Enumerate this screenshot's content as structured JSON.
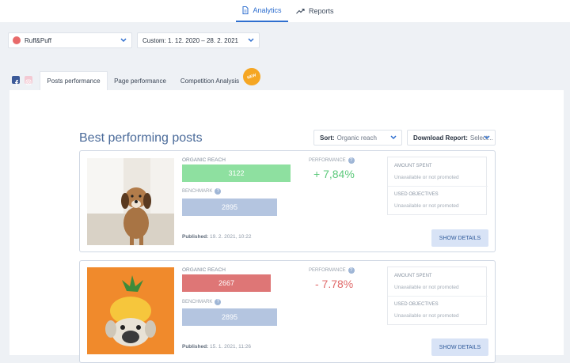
{
  "nav": {
    "analytics": "Analytics",
    "reports": "Reports"
  },
  "filters": {
    "page": "Ruff&Puff",
    "date_range": "Custom: 1. 12. 2020 – 28. 2. 2021"
  },
  "tabs": [
    "Posts performance",
    "Page performance",
    "Competition Analysis"
  ],
  "new_badge": "NEW",
  "section_title": "Best performing posts",
  "sort": {
    "label": "Sort:",
    "value": "Organic reach"
  },
  "download": {
    "label": "Download Report:",
    "value": "Select..."
  },
  "labels": {
    "organic_reach": "ORGANIC REACH",
    "benchmark": "BENCHMARK",
    "performance": "PERFORMANCE",
    "amount_spent": "AMOUNT SPENT",
    "used_objectives": "USED OBJECTIVES",
    "published": "Published:",
    "show_details": "SHOW DETAILS",
    "not_promoted": "Unavailable or not promoted"
  },
  "posts": [
    {
      "organic_reach": "3122",
      "benchmark": "2895",
      "performance": "+ 7,84%",
      "performance_color": "#5cc97b",
      "reach_color": "#8ee0a0",
      "published": "19. 2. 2021, 10:22"
    },
    {
      "organic_reach": "2667",
      "benchmark": "2895",
      "performance": "- 7.78%",
      "performance_color": "#e06b6b",
      "reach_color": "#de7676",
      "published": "15. 1. 2021, 11:26"
    }
  ],
  "colors": {
    "accent": "#2f6fcf",
    "benchmark_bar": "#b4c5e0",
    "button_bg": "#d8e3f6"
  }
}
